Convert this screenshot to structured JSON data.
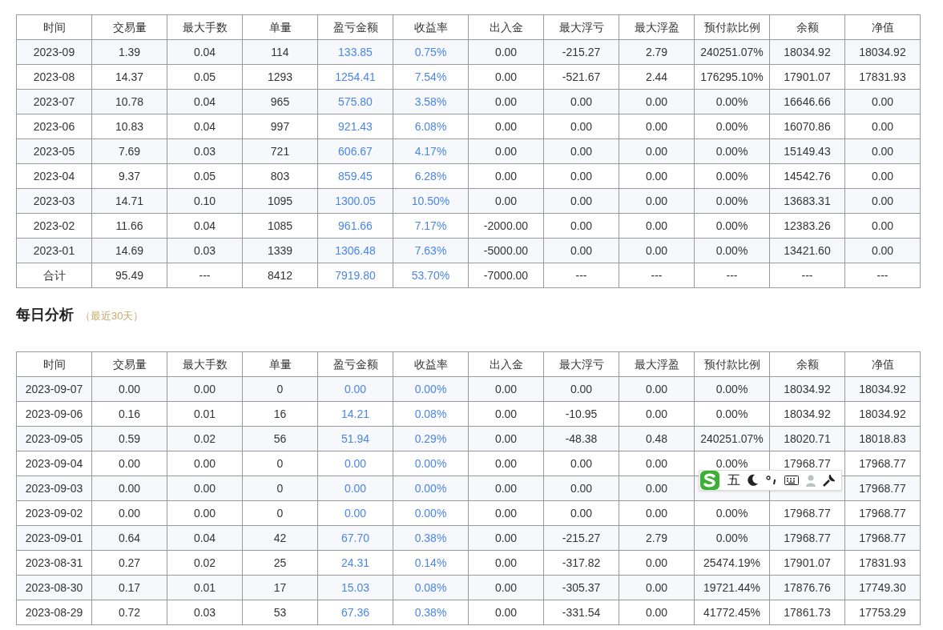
{
  "monthly_table": {
    "columns": [
      "时间",
      "交易量",
      "最大手数",
      "单量",
      "盈亏金额",
      "收益率",
      "出入金",
      "最大浮亏",
      "最大浮盈",
      "预付款比例",
      "余额",
      "净值"
    ],
    "rows": [
      [
        "2023-09",
        "1.39",
        "0.04",
        "114",
        "133.85",
        "0.75%",
        "0.00",
        "-215.27",
        "2.79",
        "240251.07%",
        "18034.92",
        "18034.92"
      ],
      [
        "2023-08",
        "14.37",
        "0.05",
        "1293",
        "1254.41",
        "7.54%",
        "0.00",
        "-521.67",
        "2.44",
        "176295.10%",
        "17901.07",
        "17831.93"
      ],
      [
        "2023-07",
        "10.78",
        "0.04",
        "965",
        "575.80",
        "3.58%",
        "0.00",
        "0.00",
        "0.00",
        "0.00%",
        "16646.66",
        "0.00"
      ],
      [
        "2023-06",
        "10.83",
        "0.04",
        "997",
        "921.43",
        "6.08%",
        "0.00",
        "0.00",
        "0.00",
        "0.00%",
        "16070.86",
        "0.00"
      ],
      [
        "2023-05",
        "7.69",
        "0.03",
        "721",
        "606.67",
        "4.17%",
        "0.00",
        "0.00",
        "0.00",
        "0.00%",
        "15149.43",
        "0.00"
      ],
      [
        "2023-04",
        "9.37",
        "0.05",
        "803",
        "859.45",
        "6.28%",
        "0.00",
        "0.00",
        "0.00",
        "0.00%",
        "14542.76",
        "0.00"
      ],
      [
        "2023-03",
        "14.71",
        "0.10",
        "1095",
        "1300.05",
        "10.50%",
        "0.00",
        "0.00",
        "0.00",
        "0.00%",
        "13683.31",
        "0.00"
      ],
      [
        "2023-02",
        "11.66",
        "0.04",
        "1085",
        "961.66",
        "7.17%",
        "-2000.00",
        "0.00",
        "0.00",
        "0.00%",
        "12383.26",
        "0.00"
      ],
      [
        "2023-01",
        "14.69",
        "0.03",
        "1339",
        "1306.48",
        "7.63%",
        "-5000.00",
        "0.00",
        "0.00",
        "0.00%",
        "13421.60",
        "0.00"
      ],
      [
        "合计",
        "95.49",
        "---",
        "8412",
        "7919.80",
        "53.70%",
        "-7000.00",
        "---",
        "---",
        "---",
        "---",
        "---"
      ]
    ]
  },
  "daily_section": {
    "title": "每日分析",
    "subtitle": "（最近30天）"
  },
  "daily_table": {
    "columns": [
      "时间",
      "交易量",
      "最大手数",
      "单量",
      "盈亏金额",
      "收益率",
      "出入金",
      "最大浮亏",
      "最大浮盈",
      "预付款比例",
      "余额",
      "净值"
    ],
    "rows": [
      [
        "2023-09-07",
        "0.00",
        "0.00",
        "0",
        "0.00",
        "0.00%",
        "0.00",
        "0.00",
        "0.00",
        "0.00%",
        "18034.92",
        "18034.92"
      ],
      [
        "2023-09-06",
        "0.16",
        "0.01",
        "16",
        "14.21",
        "0.08%",
        "0.00",
        "-10.95",
        "0.00",
        "0.00%",
        "18034.92",
        "18034.92"
      ],
      [
        "2023-09-05",
        "0.59",
        "0.02",
        "56",
        "51.94",
        "0.29%",
        "0.00",
        "-48.38",
        "0.48",
        "240251.07%",
        "18020.71",
        "18018.83"
      ],
      [
        "2023-09-04",
        "0.00",
        "0.00",
        "0",
        "0.00",
        "0.00%",
        "0.00",
        "0.00",
        "0.00",
        "0.00%",
        "17968.77",
        "17968.77"
      ],
      [
        "2023-09-03",
        "0.00",
        "0.00",
        "0",
        "0.00",
        "0.00%",
        "0.00",
        "0.00",
        "0.00",
        null,
        null,
        "17968.77"
      ],
      [
        "2023-09-02",
        "0.00",
        "0.00",
        "0",
        "0.00",
        "0.00%",
        "0.00",
        "0.00",
        "0.00",
        "0.00%",
        "17968.77",
        "17968.77"
      ],
      [
        "2023-09-01",
        "0.64",
        "0.04",
        "42",
        "67.70",
        "0.38%",
        "0.00",
        "-215.27",
        "2.79",
        "0.00%",
        "17968.77",
        "17968.77"
      ],
      [
        "2023-08-31",
        "0.27",
        "0.02",
        "25",
        "24.31",
        "0.14%",
        "0.00",
        "-317.82",
        "0.00",
        "25474.19%",
        "17901.07",
        "17831.93"
      ],
      [
        "2023-08-30",
        "0.17",
        "0.01",
        "17",
        "15.03",
        "0.08%",
        "0.00",
        "-305.37",
        "0.00",
        "19721.44%",
        "17876.76",
        "17749.30"
      ],
      [
        "2023-08-29",
        "0.72",
        "0.03",
        "53",
        "67.36",
        "0.38%",
        "0.00",
        "-331.54",
        "0.00",
        "41772.45%",
        "17861.73",
        "17753.29"
      ]
    ]
  },
  "ime_toolbar": {
    "mode": "五"
  }
}
